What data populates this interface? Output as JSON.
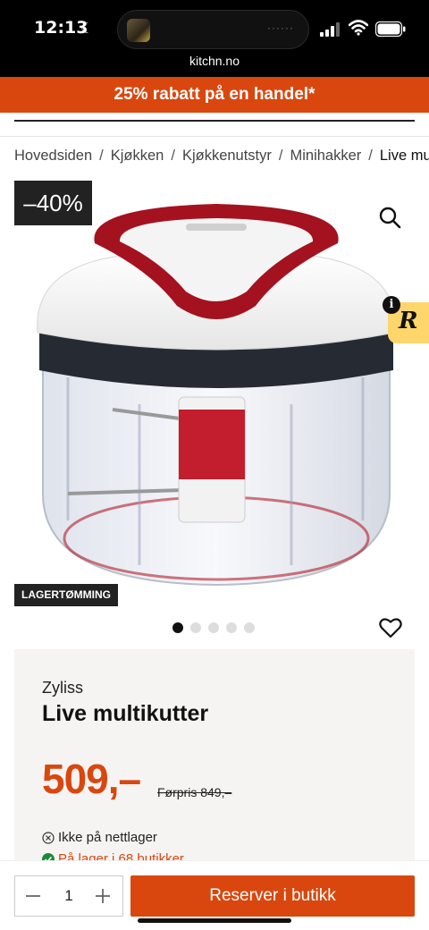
{
  "status_bar": {
    "time": "12:13",
    "url": "kitchn.no"
  },
  "promo": {
    "text": "25% rabatt på en handel*"
  },
  "breadcrumb": [
    "Hovedsiden",
    "Kjøkken",
    "Kjøkkenutstyr",
    "Minihakker",
    "Live mult"
  ],
  "breadcrumb_separator": "/",
  "product": {
    "discount": "–40%",
    "label": "LAGERTØMMING",
    "image_count": 5,
    "active_image": 0,
    "brand": "Zyliss",
    "name": "Live multikutter",
    "price": "509,–",
    "old_price": "Førpris 849,–",
    "stock_online": "Ikke på nettlager",
    "stock_store": "På lager i 68 butikker"
  },
  "bottom_bar": {
    "quantity": "1",
    "reserve_label": "Reserver i butikk"
  },
  "colors": {
    "brand_orange": "#d9470f",
    "dark": "#222222",
    "card_bg": "#f6f4f3"
  }
}
